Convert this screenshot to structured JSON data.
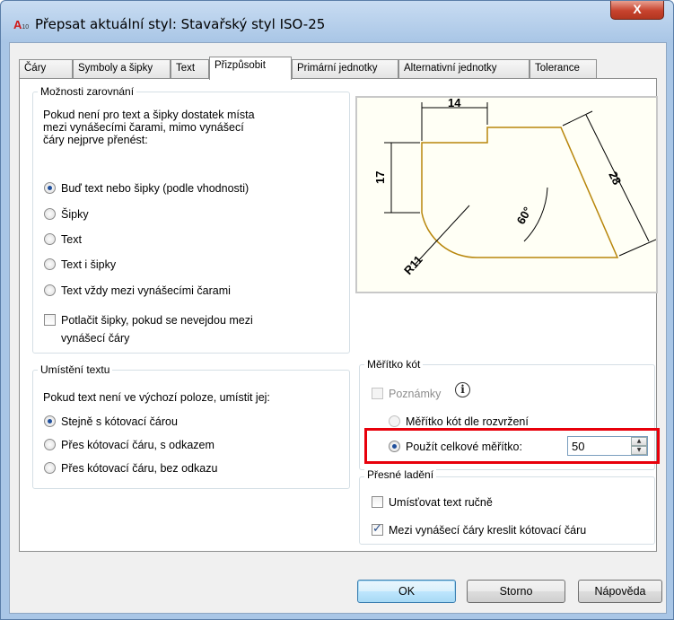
{
  "window": {
    "title": "Přepsat aktuální styl: Stavařský styl ISO-25",
    "app_icon": "A",
    "app_icon_sub": "10",
    "close_glyph": "X"
  },
  "tabs": [
    {
      "label": "Čáry"
    },
    {
      "label": "Symboly a šipky"
    },
    {
      "label": "Text"
    },
    {
      "label": "Přizpůsobit",
      "active": true
    },
    {
      "label": "Primární jednotky"
    },
    {
      "label": "Alternativní jednotky"
    },
    {
      "label": "Tolerance"
    }
  ],
  "fit_options": {
    "legend": "Možnosti zarovnání",
    "description_lines": [
      "Pokud není pro text a šipky dostatek místa",
      "mezi vynášecími čarami, mimo vynášecí",
      "čáry nejprve přenést:"
    ],
    "radios": [
      {
        "label": "Buď text nebo šipky (podle vhodnosti)",
        "checked": true
      },
      {
        "label": "Šipky",
        "checked": false
      },
      {
        "label": "Text",
        "checked": false
      },
      {
        "label": "Text i šipky",
        "checked": false
      },
      {
        "label": "Text vždy mezi vynášecími čarami",
        "checked": false
      }
    ],
    "suppress_check": {
      "line1": "Potlačit šipky, pokud se nevejdou mezi",
      "line2": "vynášecí čáry",
      "checked": false
    }
  },
  "text_placement": {
    "legend": "Umístění textu",
    "description": "Pokud text není ve výchozí poloze, umístit jej:",
    "radios": [
      {
        "label": "Stejně s kótovací čárou",
        "checked": true
      },
      {
        "label": "Přes kótovací čáru, s odkazem",
        "checked": false
      },
      {
        "label": "Přes kótovací čáru, bez odkazu",
        "checked": false
      }
    ]
  },
  "preview": {
    "dim_top": "14",
    "dim_left": "17",
    "dim_right": "28",
    "dim_angle": "60°",
    "dim_radius": "R11"
  },
  "scale": {
    "legend": "Měřítko kót",
    "annotative_label": "Poznámky",
    "annotative_checked": false,
    "info_glyph": "i",
    "radio_layout": "Měřítko kót dle rozvržení",
    "radio_overall": "Použít celkové měřítko:",
    "overall_value": "50",
    "spin_up": "▲",
    "spin_down": "▼"
  },
  "fine_tuning": {
    "legend": "Přesné ladění",
    "manual_text": {
      "label": "Umísťovat text ručně",
      "checked": false
    },
    "draw_line": {
      "label": "Mezi vynášecí čáry kreslit kótovací čáru",
      "checked": true
    }
  },
  "buttons": {
    "ok": "OK",
    "cancel": "Storno",
    "help": "Nápověda"
  },
  "colors": {
    "highlight": "#e8000b",
    "drawing_outline": "#b8860b"
  }
}
